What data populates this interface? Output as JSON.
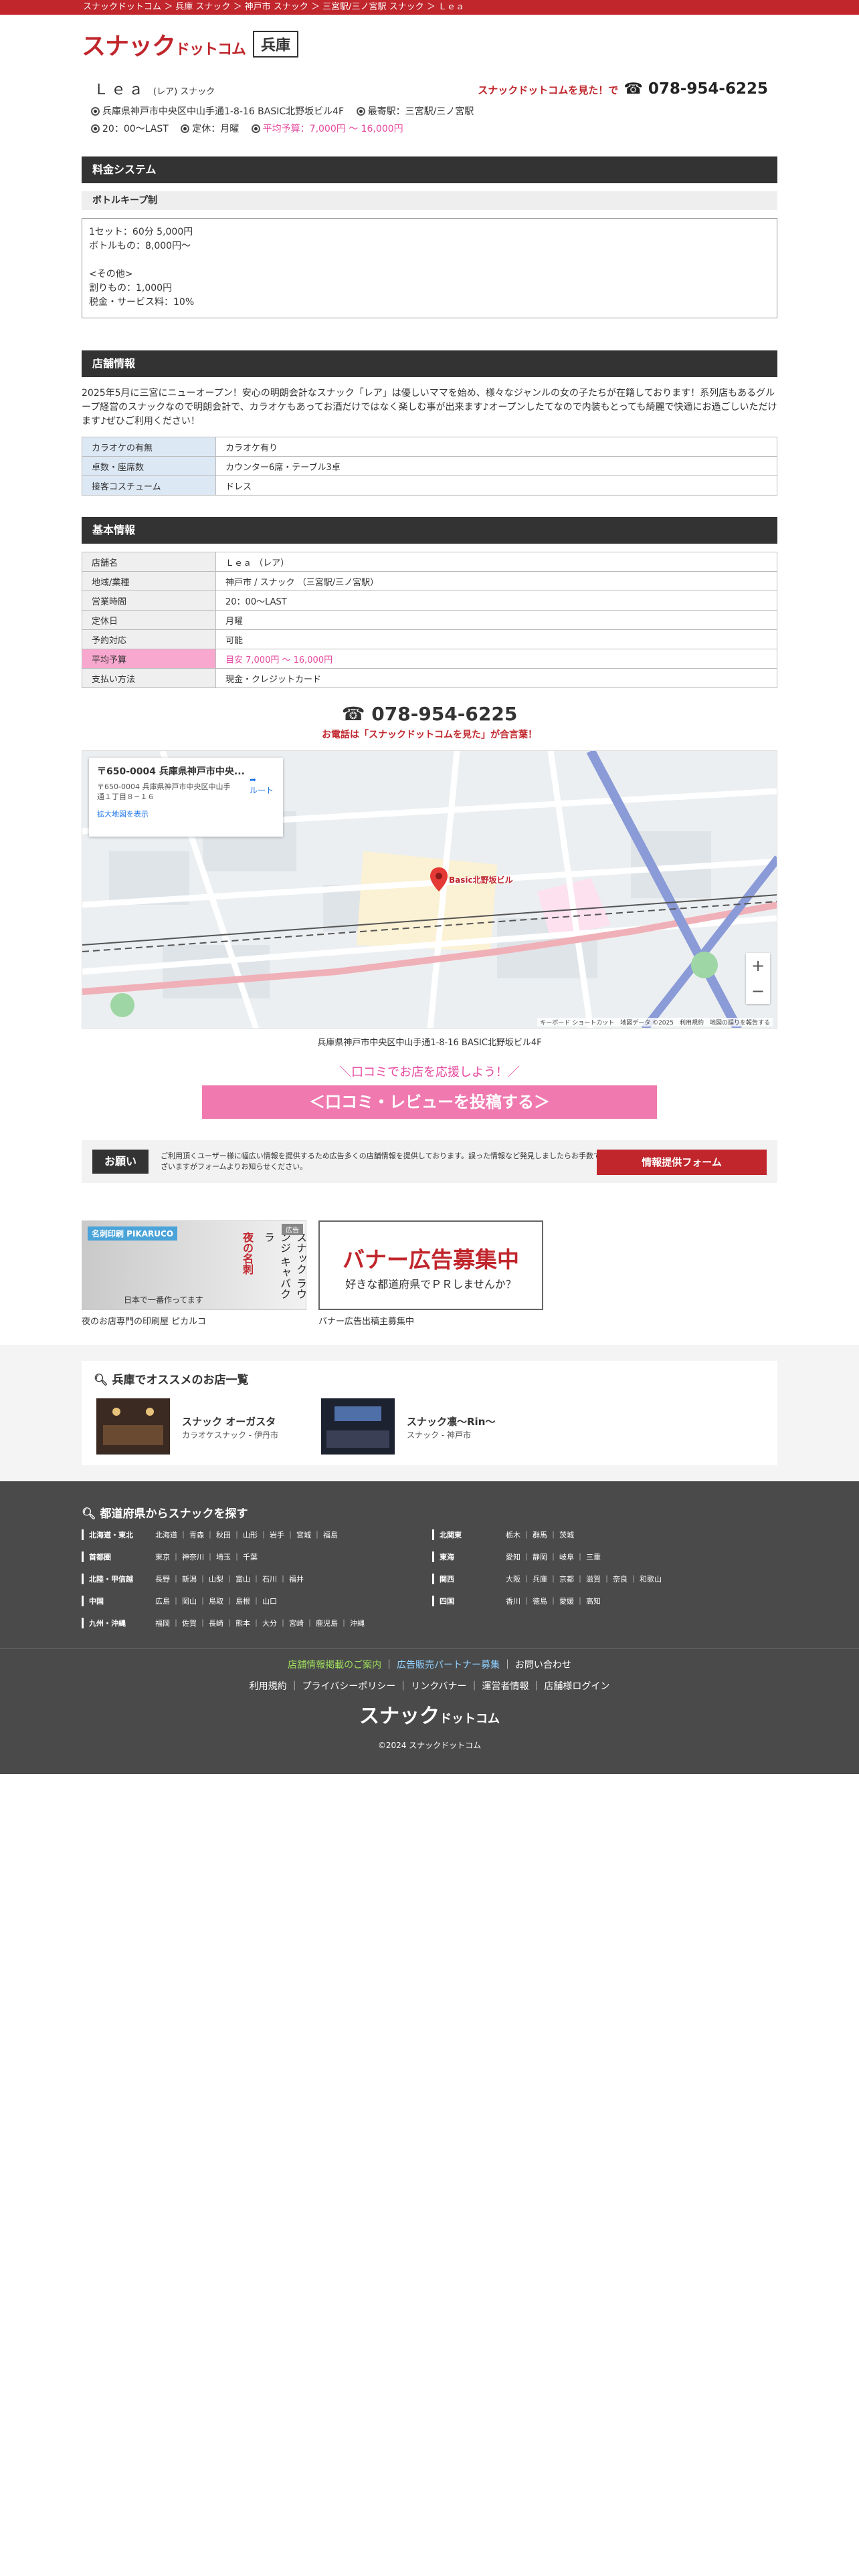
{
  "breadcrumb": "スナックドットコム ＞ 兵庫 スナック ＞ 神戸市 スナック ＞ 三宮駅/三ノ宮駅 スナック ＞ Ｌｅａ",
  "logo": {
    "main": "スナック",
    "sub": "ドットコム"
  },
  "pref_label": "兵庫",
  "shop": {
    "name": "Ｌｅａ",
    "kana": "(レア) スナック",
    "callout": "スナックドットコムを見た！で",
    "tel": "☎ 078-954-6225",
    "address": "兵庫県神戸市中央区中山手通1-8-16 BASIC北野坂ビル4F",
    "station": "最寄駅：三宮駅/三ノ宮駅",
    "hours": "20：00〜LAST",
    "holiday": "定休：月曜",
    "budget": "平均予算：7,000円 〜 16,000円"
  },
  "price": {
    "section": "料金システム",
    "sub": "ボトルキープ制",
    "lines": [
      "1セット：60分 5,000円",
      "ボトルもの：8,000円〜",
      "",
      "<その他>",
      "割りもの：1,000円",
      "税金・サービス料：10%"
    ]
  },
  "store": {
    "section": "店舗情報",
    "intro": "2025年5月に三宮にニューオープン！安心の明朗会計なスナック「レア」は優しいママを始め、様々なジャンルの女の子たちが在籍しております！系列店もあるグループ経営のスナックなので明朗会計で、カラオケもあってお酒だけではなく楽しむ事が出来ます♪オープンしたてなので内装もとっても綺麗で快適にお過ごしいただけます♪ぜひご利用ください！",
    "rows": [
      {
        "k": "カラオケの有無",
        "v": "カラオケ有り"
      },
      {
        "k": "卓数・座席数",
        "v": "カウンター6席・テーブル3卓"
      },
      {
        "k": "接客コスチューム",
        "v": "ドレス"
      }
    ]
  },
  "basic": {
    "section": "基本情報",
    "rows": [
      {
        "k": "店舗名",
        "v": "Ｌｅａ （レア）"
      },
      {
        "k": "地域/業種",
        "v": "神戸市 / スナック （三宮駅/三ノ宮駅）"
      },
      {
        "k": "営業時間",
        "v": "20：00〜LAST"
      },
      {
        "k": "定休日",
        "v": "月曜"
      },
      {
        "k": "予約対応",
        "v": "可能"
      },
      {
        "k": "平均予算",
        "v": "目安 7,000円 〜 16,000円"
      },
      {
        "k": "支払い方法",
        "v": "現金・クレジットカード"
      }
    ]
  },
  "tel_block": {
    "tel": "☎ 078-954-6225",
    "note": "お電話は「スナックドットコムを見た」が合言葉！"
  },
  "map": {
    "card_title": "〒650-0004 兵庫県神戸市中央...",
    "card_addr": "〒650-0004 兵庫県神戸市中央区中山手通１丁目８−１６",
    "card_route": "ルート",
    "card_link": "拡大地図を表示",
    "pin_label": "Basic北野坂ビル",
    "zoom_in": "+",
    "zoom_out": "−",
    "footer": "キーボード ショートカット　地図データ ©2025　利用規約　地図の誤りを報告する",
    "address": "兵庫県神戸市中央区中山手通1-8-16 BASIC北野坂ビル4F"
  },
  "review": {
    "lead": "＼口コミでお店を応援しよう！／",
    "button": "＜口コミ・レビューを投稿する＞"
  },
  "notice": {
    "label": "お願い",
    "text": "ご利用頂くユーザー様に幅広い情報を提供するため広告多くの店舗情報を提供しております。誤った情報など発見しましたらお手数ではございますがフォームよりお知らせください。",
    "button": "情報提供フォーム"
  },
  "banners": [
    {
      "brand": "名刺印刷 PIKARUCO",
      "red": "夜の名刺",
      "black": "スナック ラウンジ キャバクラ",
      "tag": "広告",
      "bottom": "日本で一番作ってます",
      "caption": "夜のお店専門の印刷屋 ピカルコ"
    },
    {
      "big": "バナー広告募集中",
      "small": "好きな都道府県でＰＲしませんか？",
      "caption": "バナー広告出稿主募集中"
    }
  ],
  "reco": {
    "title": "兵庫でオススメのお店一覧",
    "items": [
      {
        "name": "スナック オーガスタ",
        "sub": "カラオケスナック - 伊丹市"
      },
      {
        "name": "スナック凛〜Rin〜",
        "sub": "スナック - 神戸市"
      }
    ]
  },
  "footer": {
    "title": "都道府県からスナックを探す",
    "left": [
      {
        "k": "北海道・東北",
        "v": "北海道 ｜ 青森 ｜ 秋田 ｜ 山形 ｜ 岩手 ｜ 宮城 ｜ 福島"
      },
      {
        "k": "首都圏",
        "v": "東京 ｜ 神奈川 ｜ 埼玉 ｜ 千葉"
      },
      {
        "k": "北陸・甲信越",
        "v": "長野 ｜ 新潟 ｜ 山梨 ｜ 富山 ｜ 石川 ｜ 福井"
      },
      {
        "k": "中国",
        "v": "広島 ｜ 岡山 ｜ 鳥取 ｜ 島根 ｜ 山口"
      },
      {
        "k": "九州・沖縄",
        "v": "福岡 ｜ 佐賀 ｜ 長崎 ｜ 熊本 ｜ 大分 ｜ 宮崎 ｜ 鹿児島 ｜ 沖縄"
      }
    ],
    "right": [
      {
        "k": "北関東",
        "v": "栃木 ｜ 群馬 ｜ 茨城"
      },
      {
        "k": "東海",
        "v": "愛知 ｜ 静岡 ｜ 岐阜 ｜ 三重"
      },
      {
        "k": "関西",
        "v": "大阪 ｜ 兵庫 ｜ 京都 ｜ 滋賀 ｜ 奈良 ｜ 和歌山"
      },
      {
        "k": "四国",
        "v": "香川 ｜ 徳島 ｜ 愛媛 ｜ 高知"
      }
    ],
    "link_green": "店舗情報掲載のご案内",
    "link_blue": "広告販売パートナー募集",
    "link_contact": "お問い合わせ",
    "links2": [
      "利用規約",
      "プライバシーポリシー",
      "リンクバナー",
      "運営者情報",
      "店舗様ログイン"
    ],
    "logo_main": "スナック",
    "logo_sub": "ドットコム",
    "copyright": "©2024 スナックドットコム"
  },
  "colors": {
    "brand": "#c0262c",
    "pink": "#e5479e",
    "dark": "#333333",
    "footer": "#4a4a4a"
  }
}
